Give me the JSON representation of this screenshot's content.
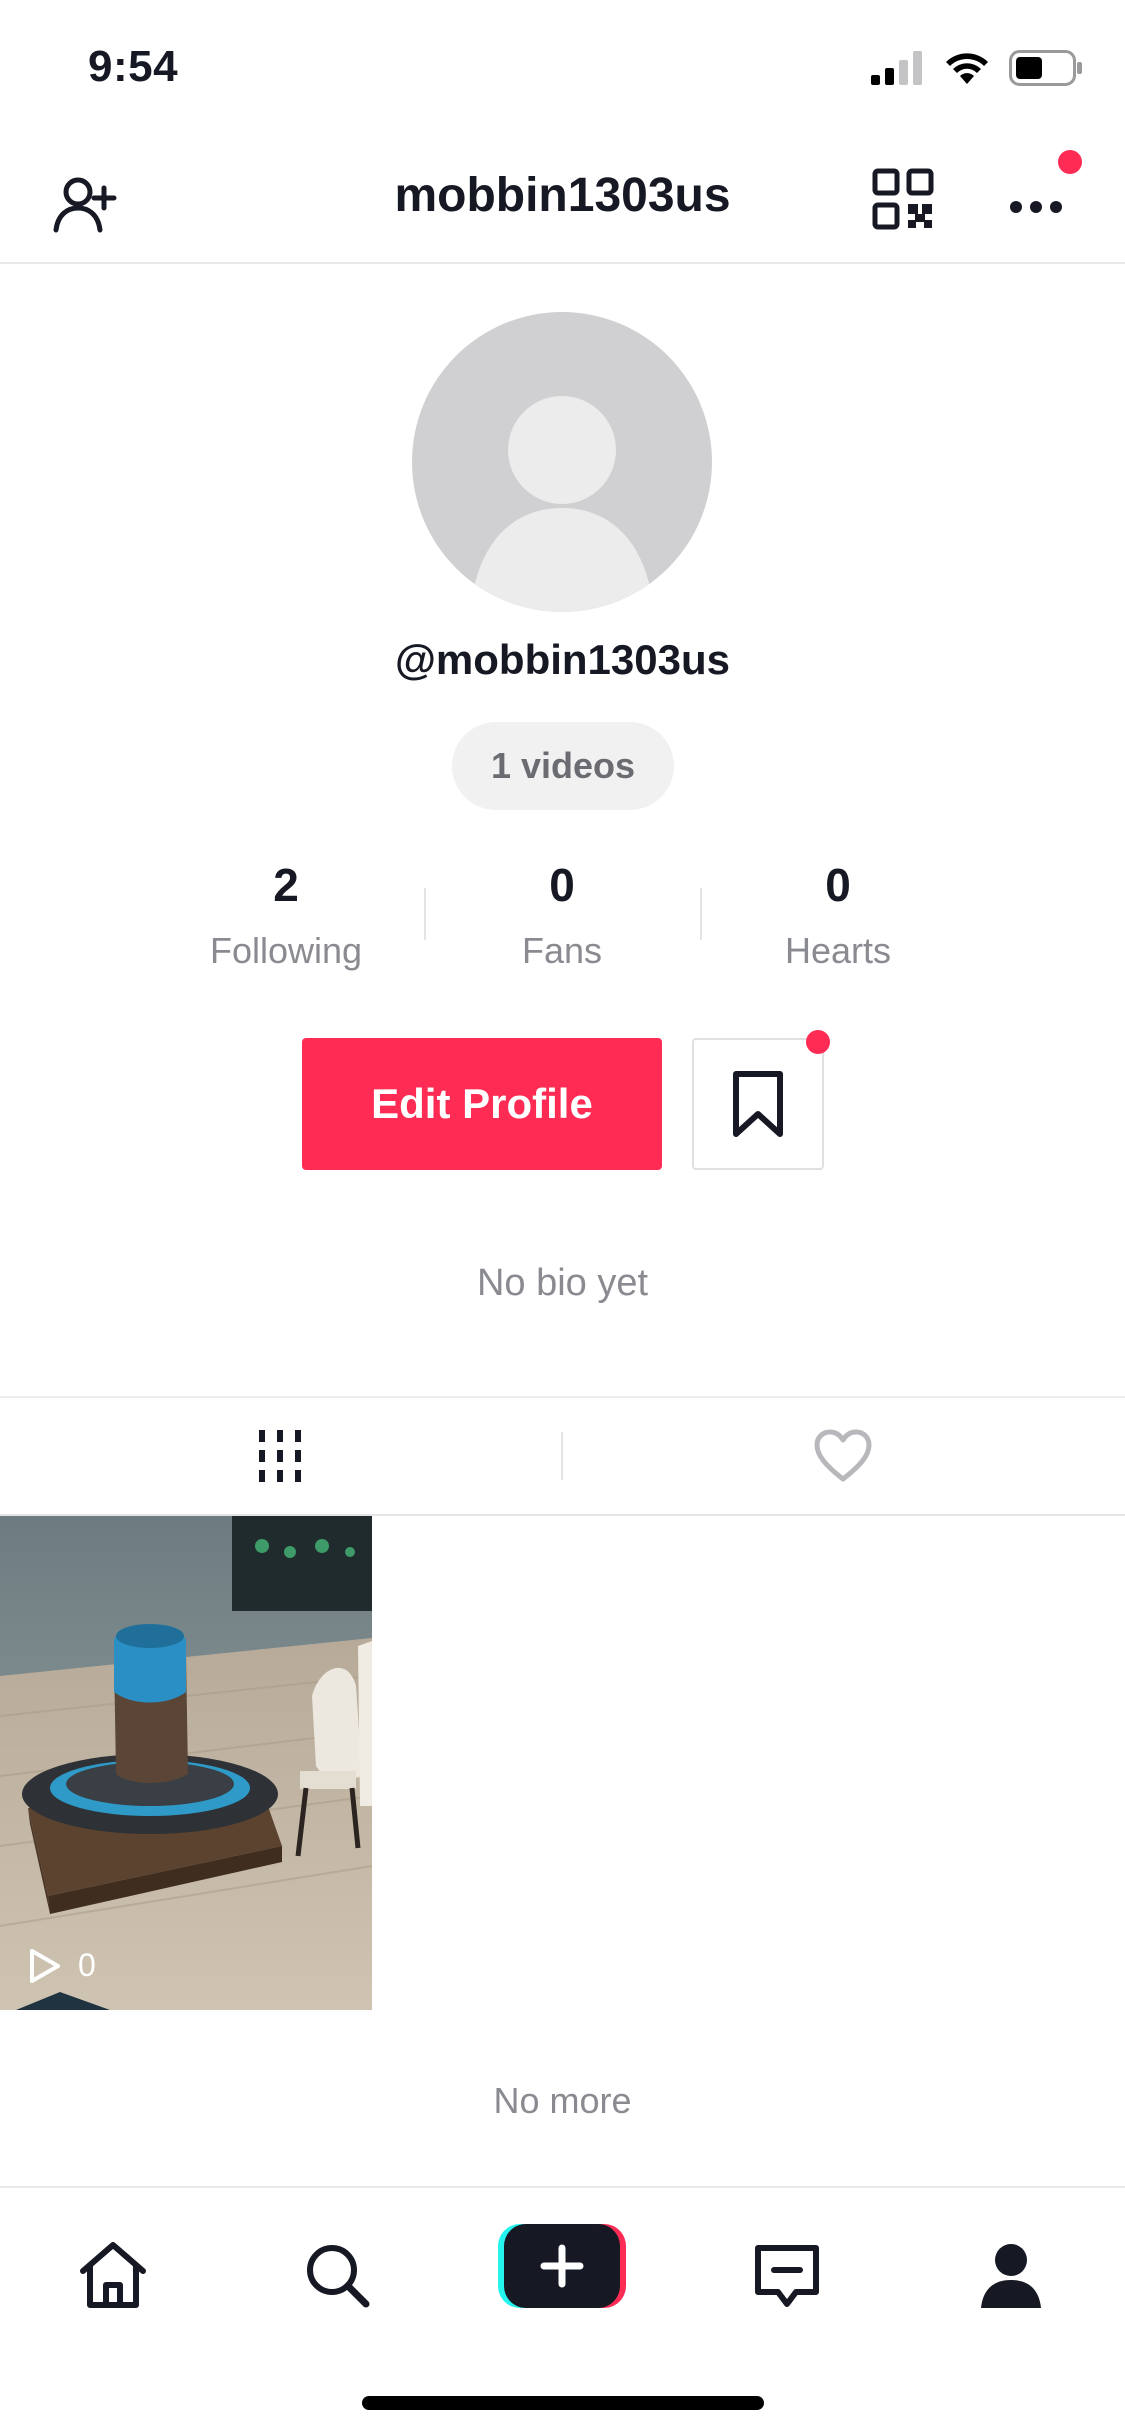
{
  "status_bar": {
    "time": "9:54"
  },
  "header": {
    "title": "mobbin1303us"
  },
  "profile": {
    "handle": "@mobbin1303us",
    "videos_label": "1 videos",
    "bio": "No bio yet"
  },
  "stats": [
    {
      "value": "2",
      "label": "Following"
    },
    {
      "value": "0",
      "label": "Fans"
    },
    {
      "value": "0",
      "label": "Hearts"
    }
  ],
  "actions": {
    "edit_profile": "Edit Profile"
  },
  "videos": [
    {
      "views": "0"
    }
  ],
  "footer": {
    "no_more": "No more"
  },
  "colors": {
    "accent": "#fe2c55",
    "text": "#161823",
    "muted": "#8a8b91"
  }
}
